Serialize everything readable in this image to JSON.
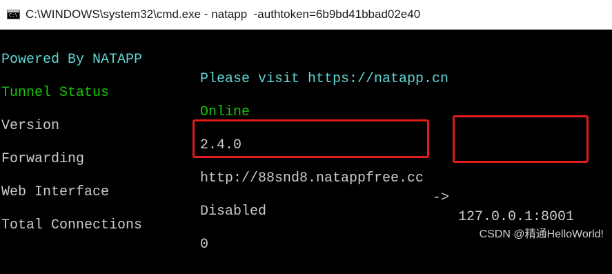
{
  "window": {
    "title": "C:\\WINDOWS\\system32\\cmd.exe - natapp  -authtoken=6b9bd41bbad02e40",
    "icon_text": "C:\\"
  },
  "rows": [
    {
      "label": "Powered By NATAPP",
      "value": "Please visit https://natapp.cn"
    },
    {
      "label": "Tunnel Status",
      "value": "Online"
    },
    {
      "label": "Version",
      "value": "2.4.0"
    },
    {
      "label": "Forwarding",
      "value": "http://88snd8.natappfree.cc",
      "arrow": "->",
      "target": "127.0.0.1:8001"
    },
    {
      "label": "Web Interface",
      "value": "Disabled"
    },
    {
      "label": "Total Connections",
      "value": "0"
    }
  ],
  "colors": {
    "cyan": "#61d6d6",
    "green": "#16c60c",
    "gray": "#cccccc",
    "highlight": "#e21b1b"
  },
  "watermark": "CSDN @精通HelloWorld!"
}
